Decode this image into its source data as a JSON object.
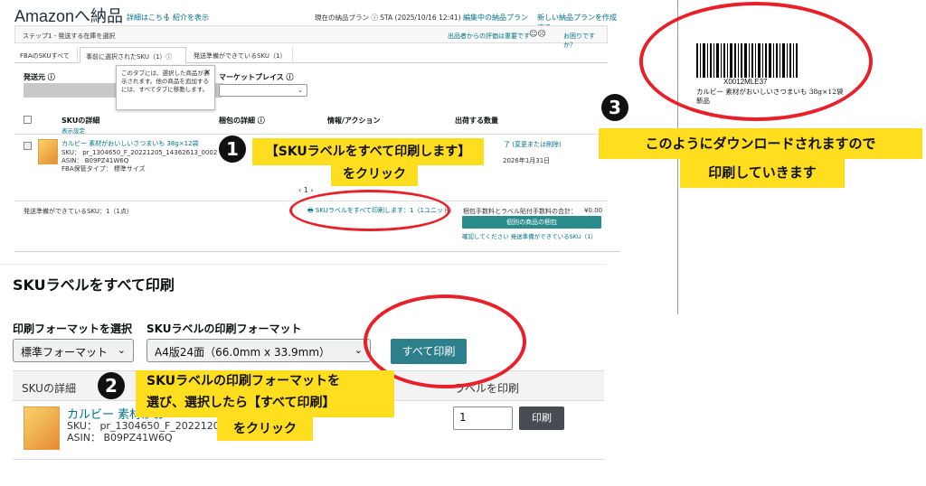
{
  "top": {
    "brand": "Amazonへ納品",
    "link_details": "詳細はこちら",
    "link_intro": "紹介を表示",
    "current_plan": "現在の納品プラン ⓘ STA (2025/10/16 12:41)",
    "link_edit_plan": "編集中の納品プラン",
    "link_new_plan": "新しい納品プランを作成する",
    "step_label": "ステップ1 - 発送する在庫を選択",
    "feedback": "出品者からの評価は重要です",
    "help": "お困りですか？",
    "tabs": [
      "FBAのSKUすべて",
      "事前に選択されたSKU（1）ⓘ",
      "発送準備ができているSKU（1）"
    ],
    "ship_from": "発送元 ⓘ",
    "marketplace": "マーケットプレイス ⓘ",
    "tooltip": "このタブには、選択した商品が表示されます。他の商品を追加するには、すべてタブに移動します。",
    "col_sku": "SKUの詳細",
    "show_settings": "表示設定",
    "col_pack": "梱包の詳細 ⓘ",
    "col_info": "情報/アクション",
    "col_qty": "出荷する数量",
    "product_name": "カルビー 素材がおいしいさつまいも 38g×12袋",
    "sku_line": "SKU： pr_1304650_F_20221205_14362613_0002",
    "asin_line": "ASIN： B09PZ41W6Q",
    "storage_type": "FBA保管タイプ： 標準サイズ",
    "change_link": "了 (変更または削除)",
    "expiry": "2026年1月31日",
    "pager": "‹ 1 ›",
    "ready_count": "発送準備ができているSKU：1（1点）",
    "print_all_link": "SKUラベルをすべて印刷します：1（1ユニット）",
    "fee_total": "梱包手数料とラベル貼付手数料の合計：",
    "fee_value": "¥0.00",
    "pack_button": "個別の商品の梱包",
    "confirm_text": "確認してください 発送準備ができているSKU（1）"
  },
  "label_preview": {
    "code": "X0012MLE37",
    "name": "カルビー 素材がおいしいさつまいも 38g×12袋",
    "condition": "新品"
  },
  "callouts": {
    "one_number": "1",
    "one_text": "【SKUラベルをすべて印刷します】",
    "one_sub": "をクリック",
    "two_number": "2",
    "two_line1": "SKUラベルの印刷フォーマットを",
    "two_line2": "選び、選択したら【すべて印刷】",
    "two_line3": "をクリック",
    "three_number": "3",
    "three_line1": "このようにダウンロードされますので",
    "three_line2": "印刷していきます"
  },
  "bottom": {
    "title": "SKUラベルをすべて印刷",
    "label_format": "印刷フォーマットを選択",
    "label_sku_format": "SKUラベルの印刷フォーマット",
    "format_value": "標準フォーマット",
    "sku_format_value": "A4版24面（66.0mm x 33.9mm）",
    "print_all_button": "すべて印刷",
    "col_sku": "SKUの詳細",
    "col_print": "ラベルを印刷",
    "product_name": "カルビー 素材がお",
    "sku_line": "SKU： pr_1304650_F_2022120",
    "asin_line": "ASIN： B09PZ41W6Q",
    "qty_value": "1",
    "print_button": "印刷"
  }
}
